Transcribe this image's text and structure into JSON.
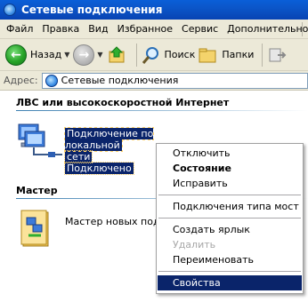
{
  "window": {
    "title": "Сетевые подключения",
    "title_icon": "network-globe-icon"
  },
  "menubar": {
    "items": [
      "Файл",
      "Правка",
      "Вид",
      "Избранное",
      "Сервис",
      "Дополнительно"
    ]
  },
  "toolbar": {
    "back_label": "Назад",
    "search_label": "Поиск",
    "folders_label": "Папки"
  },
  "address": {
    "label": "Адрес:",
    "value": "Сетевые подключения"
  },
  "groups": {
    "lan_header": "ЛВС или высокоскоростной Интернет",
    "wizard_header": "Мастер"
  },
  "items": {
    "lan_connection": {
      "line1": "Подключение по локальной",
      "line2": "сети",
      "status": "Подключено"
    },
    "wizard": {
      "label": "Мастер новых подк"
    }
  },
  "context_menu": {
    "items": [
      {
        "label": "Отключить",
        "style": "normal"
      },
      {
        "label": "Состояние",
        "style": "bold"
      },
      {
        "label": "Исправить",
        "style": "normal"
      },
      {
        "label": "Подключения типа мост",
        "style": "normal"
      },
      {
        "label": "Создать ярлык",
        "style": "normal"
      },
      {
        "label": "Удалить",
        "style": "disabled"
      },
      {
        "label": "Переименовать",
        "style": "normal"
      },
      {
        "label": "Свойства",
        "style": "highlight"
      }
    ]
  },
  "colors": {
    "title_bar": "#0b56c9",
    "selection": "#0a246a",
    "chrome": "#ece9d8"
  }
}
